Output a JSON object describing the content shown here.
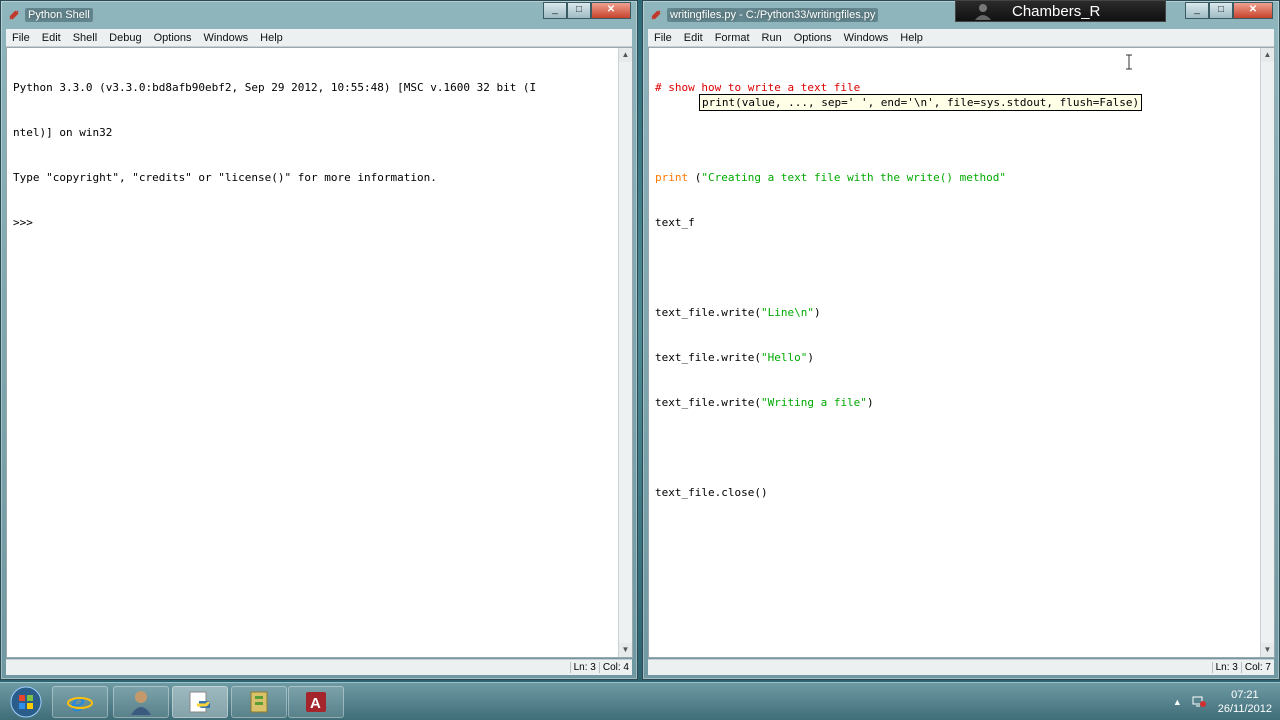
{
  "shell_window": {
    "title": "Python Shell",
    "menu": [
      "File",
      "Edit",
      "Shell",
      "Debug",
      "Options",
      "Windows",
      "Help"
    ],
    "lines": [
      "Python 3.3.0 (v3.3.0:bd8afb90ebf2, Sep 29 2012, 10:55:48) [MSC v.1600 32 bit (I",
      "ntel)] on win32",
      "Type \"copyright\", \"credits\" or \"license()\" for more information.",
      ">>> "
    ],
    "status_ln": "Ln: 3",
    "status_col": "Col: 4"
  },
  "editor_window": {
    "title": "writingfiles.py - C:/Python33/writingfiles.py",
    "menu": [
      "File",
      "Edit",
      "Format",
      "Run",
      "Options",
      "Windows",
      "Help"
    ],
    "code": {
      "line1": "# show how to write a text file",
      "line3_kw": "print",
      "line3_paren": " (",
      "line3_str": "\"Creating a text file with the write() method\"",
      "line4_prefix": "text_f",
      "line6_fn": "text_file.write(",
      "line6_str": "\"Line\\n\"",
      "line6_end": ")",
      "line7_fn": "text_file.write(",
      "line7_str": "\"Hello\"",
      "line7_end": ")",
      "line8_fn": "text_file.write(",
      "line8_str": "\"Writing a file\"",
      "line8_end": ")",
      "line10": "text_file.close()"
    },
    "calltip": "print(value, ..., sep=' ', end='\\n', file=sys.stdout, flush=False)",
    "status_ln": "Ln: 3",
    "status_col": "Col: 7"
  },
  "user": {
    "name": "Chambers_R"
  },
  "taskbar": {
    "apps": [
      "internet-explorer",
      "user-accounts",
      "python-idle",
      "file-manager",
      "microsoft-access"
    ],
    "time": "07:21",
    "date": "26/11/2012"
  },
  "colors": {
    "comment": "#dd0000",
    "keyword": "#ff7700",
    "string": "#00aa00"
  }
}
